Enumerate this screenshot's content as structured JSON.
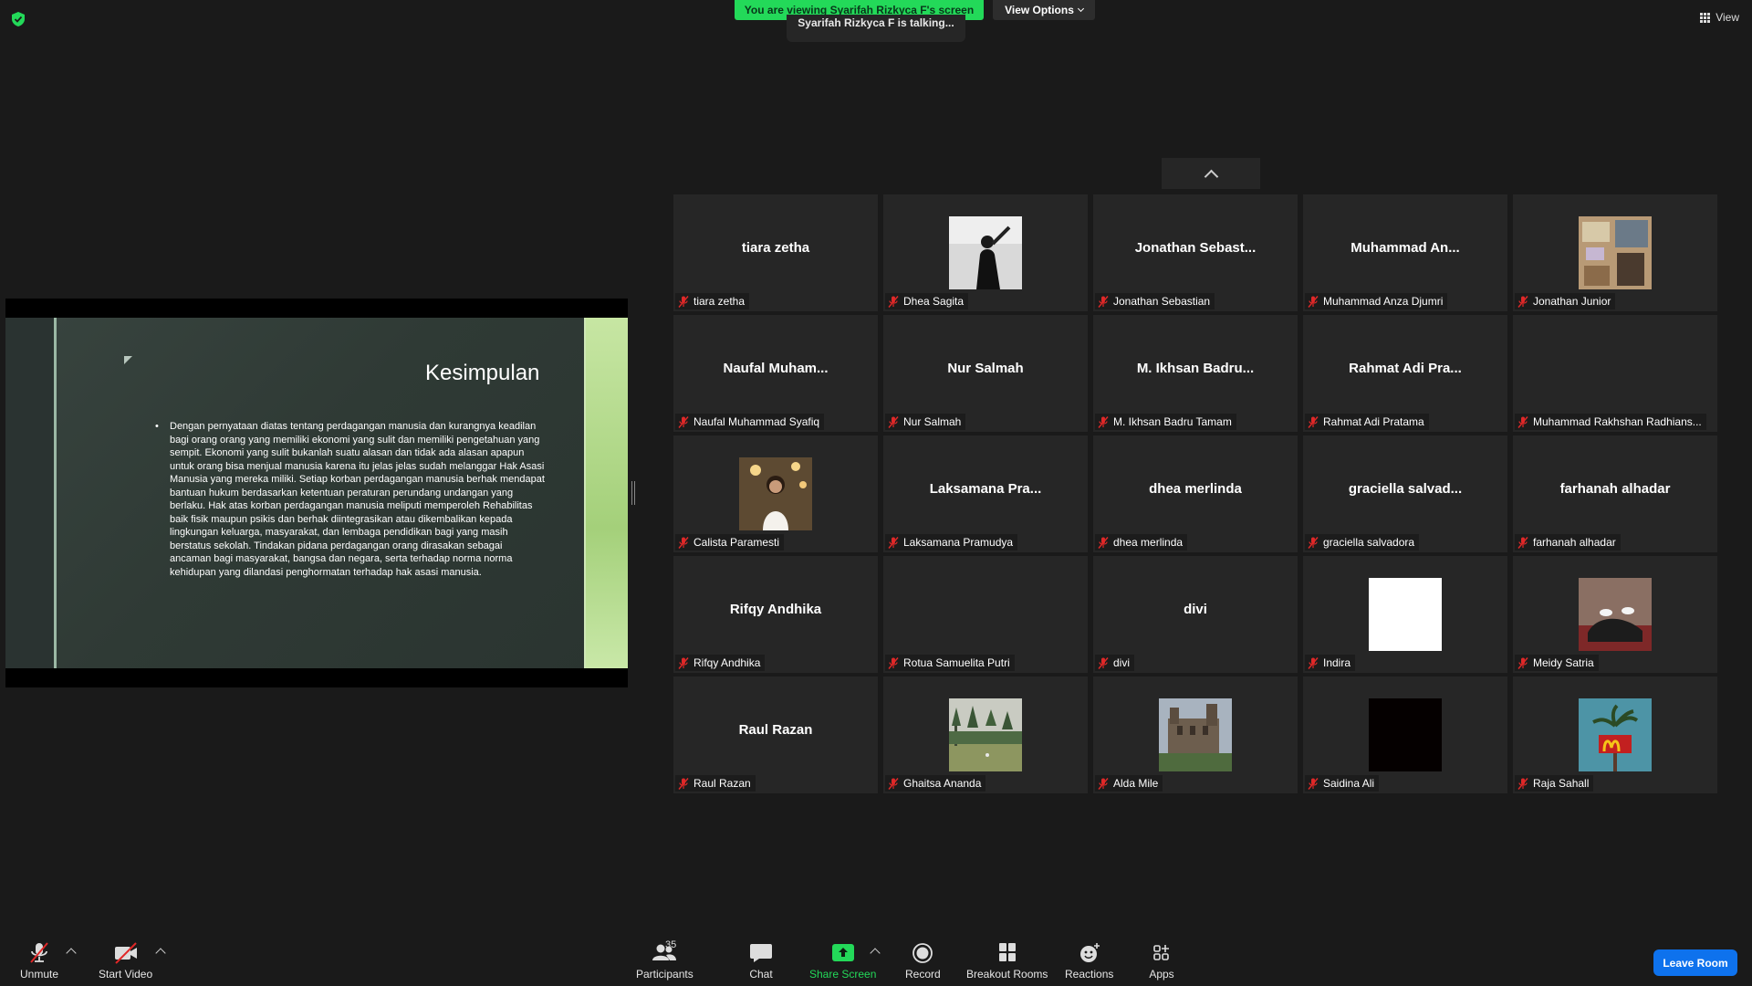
{
  "banner": {
    "viewing": "You are viewing Syarifah Rizkyca F's screen",
    "view_options": "View Options",
    "talking": "Syarifah Rizkyca F is talking...",
    "view": "View"
  },
  "slide": {
    "title": "Kesimpulan",
    "body": "Dengan pernyataan diatas tentang perdagangan manusia dan kurangnya keadilan bagi orang orang yang memiliki ekonomi yang sulit dan memiliki pengetahuan yang sempit. Ekonomi yang sulit bukanlah suatu alasan dan tidak ada alasan apapun untuk orang bisa menjual manusia karena itu jelas jelas sudah melanggar Hak Asasi Manusia yang mereka miliki. Setiap korban perdagangan manusia  berhak mendapat bantuan hukum berdasarkan ketentuan peraturan perundang undangan yang berlaku. Hak atas korban perdagangan manusia meliputi memperoleh Rehabilitas baik fisik maupun psikis dan berhak diintegrasikan atau dikembalikan kepada lingkungan keluarga, masyarakat, dan lembaga pendidikan bagi yang masih berstatus sekolah. Tindakan pidana perdagangan orang dirasakan sebagai ancaman bagi masyarakat, bangsa dan negara, serta terhadap norma norma kehidupan yang dilandasi penghormatan terhadap hak asasi manusia."
  },
  "participants": [
    {
      "center": "tiara zetha",
      "label": "tiara zetha",
      "photo": null
    },
    {
      "center": "",
      "label": "Dhea Sagita",
      "photo": "bw"
    },
    {
      "center": "Jonathan  Sebast...",
      "label": "Jonathan Sebastian",
      "photo": null
    },
    {
      "center": "Muhammad  An...",
      "label": "Muhammad Anza Djumri",
      "photo": null
    },
    {
      "center": "",
      "label": "Jonathan Junior",
      "photo": "room"
    },
    {
      "center": "Naufal  Muham...",
      "label": "Naufal Muhammad Syafiq",
      "photo": null
    },
    {
      "center": "Nur Salmah",
      "label": "Nur Salmah",
      "photo": null
    },
    {
      "center": "M. Ikhsan  Badru...",
      "label": "M. Ikhsan Badru Tamam",
      "photo": null
    },
    {
      "center": "Rahmat Adi  Pra...",
      "label": "Rahmat Adi Pratama",
      "photo": null
    },
    {
      "center": "",
      "label": "Muhammad Rakhshan Radhians...",
      "photo": null
    },
    {
      "center": "",
      "label": "Calista Paramesti",
      "photo": "girl"
    },
    {
      "center": "Laksamana  Pra...",
      "label": "Laksamana Pramudya",
      "photo": null
    },
    {
      "center": "dhea merlinda",
      "label": "dhea merlinda",
      "photo": null
    },
    {
      "center": "graciella  salvad...",
      "label": "graciella salvadora",
      "photo": null
    },
    {
      "center": "farhanah alhadar",
      "label": "farhanah alhadar",
      "photo": null
    },
    {
      "center": "Rifqy Andhika",
      "label": "Rifqy Andhika",
      "photo": null
    },
    {
      "center": "",
      "label": "Rotua Samuelita Putri",
      "photo": null
    },
    {
      "center": "divi",
      "label": "divi",
      "photo": null
    },
    {
      "center": "",
      "label": "Indira",
      "photo": "white"
    },
    {
      "center": "",
      "label": "Meidy Satria",
      "photo": "shoes"
    },
    {
      "center": "Raul Razan",
      "label": "Raul Razan",
      "photo": null
    },
    {
      "center": "",
      "label": "Ghaitsa Ananda",
      "photo": "field"
    },
    {
      "center": "",
      "label": "Alda Mile",
      "photo": "castle"
    },
    {
      "center": "",
      "label": "Saidina Ali",
      "photo": "black"
    },
    {
      "center": "",
      "label": "Raja Sahall",
      "photo": "sign"
    }
  ],
  "toolbar": {
    "unmute": "Unmute",
    "start_video": "Start Video",
    "participants": "Participants",
    "participant_count": "35",
    "chat": "Chat",
    "share_screen": "Share Screen",
    "record": "Record",
    "breakout_rooms": "Breakout Rooms",
    "reactions": "Reactions",
    "apps": "Apps",
    "leave": "Leave Room"
  },
  "colors": {
    "banner_green": "#23d959",
    "leave_blue": "#0e72ed",
    "muted_red": "#e02828"
  }
}
